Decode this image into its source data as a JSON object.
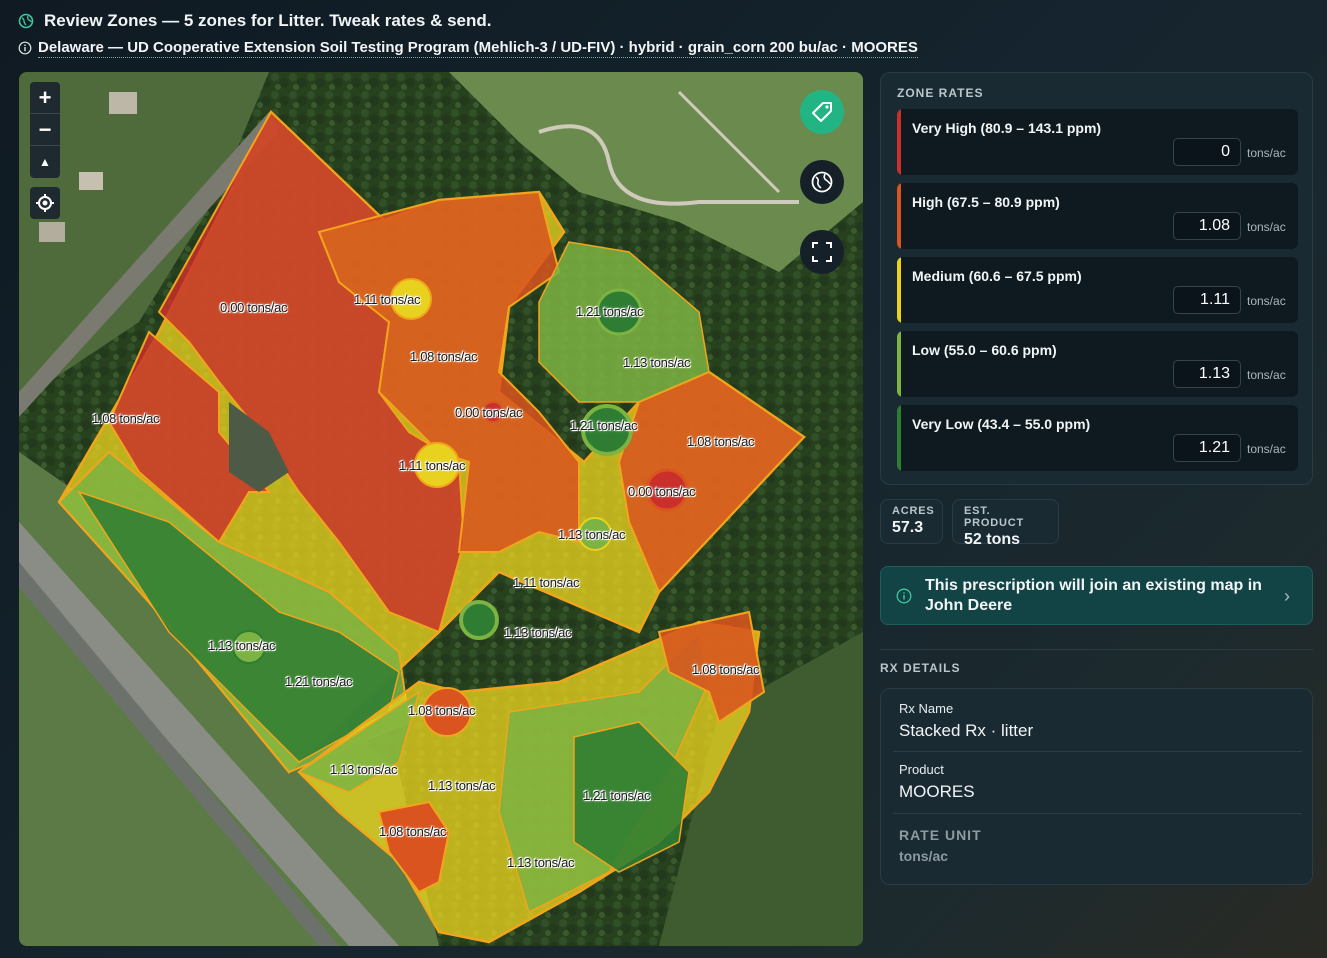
{
  "header": {
    "title": "Review Zones — 5 zones for Litter. Tweak rates & send.",
    "subtitle": "Delaware — UD Cooperative Extension Soil Testing Program (Mehlich-3 / UD-FIV) · hybrid · grain_corn 200 bu/ac · MOORES"
  },
  "map": {
    "zoom_in": "+",
    "zoom_out": "−",
    "north": "▲",
    "labels": [
      "0.00 tons/ac",
      "1.11 tons/ac",
      "1.08 tons/ac",
      "1.21 tons/ac",
      "1.13 tons/ac",
      "1.08 tons/ac",
      "0.00 tons/ac",
      "1.21 tons/ac",
      "1.08 tons/ac",
      "1.11 tons/ac",
      "0.00 tons/ac",
      "1.13 tons/ac",
      "1.11 tons/ac",
      "1.13 tons/ac",
      "1.13 tons/ac",
      "1.21 tons/ac",
      "1.08 tons/ac",
      "1.08 tons/ac",
      "1.13 tons/ac",
      "1.13 tons/ac",
      "1.21 tons/ac",
      "1.08 tons/ac",
      "1.13 tons/ac"
    ]
  },
  "zone_rates": {
    "title": "ZONE RATES",
    "unit": "tons/ac",
    "zones": [
      {
        "name": "Very High (80.9 – 143.1 ppm)",
        "rate": "0",
        "color": "#c9302c"
      },
      {
        "name": "High (67.5 – 80.9 ppm)",
        "rate": "1.08",
        "color": "#d9541e"
      },
      {
        "name": "Medium (60.6 – 67.5 ppm)",
        "rate": "1.11",
        "color": "#e8d21f"
      },
      {
        "name": "Low (55.0 – 60.6 ppm)",
        "rate": "1.13",
        "color": "#7cb342"
      },
      {
        "name": "Very Low (43.4 – 55.0 ppm)",
        "rate": "1.21",
        "color": "#2e7d32"
      }
    ]
  },
  "stats": {
    "acres_label": "ACRES",
    "acres_value": "57.3",
    "product_label": "EST. PRODUCT",
    "product_value": "52 tons"
  },
  "notice": {
    "text": "This prescription will join an existing map in John Deere"
  },
  "rx": {
    "title": "RX DETAILS",
    "name_label": "Rx Name",
    "name_value": "Stacked Rx · litter",
    "product_label": "Product",
    "product_value": "MOORES",
    "unit_label": "RATE UNIT",
    "unit_value": "tons/ac"
  },
  "colors": {
    "accent": "#22b583",
    "very_high": "#c9302c",
    "high": "#d9541e",
    "medium": "#e8d21f",
    "low": "#7cb342",
    "very_low": "#2e7d32"
  }
}
